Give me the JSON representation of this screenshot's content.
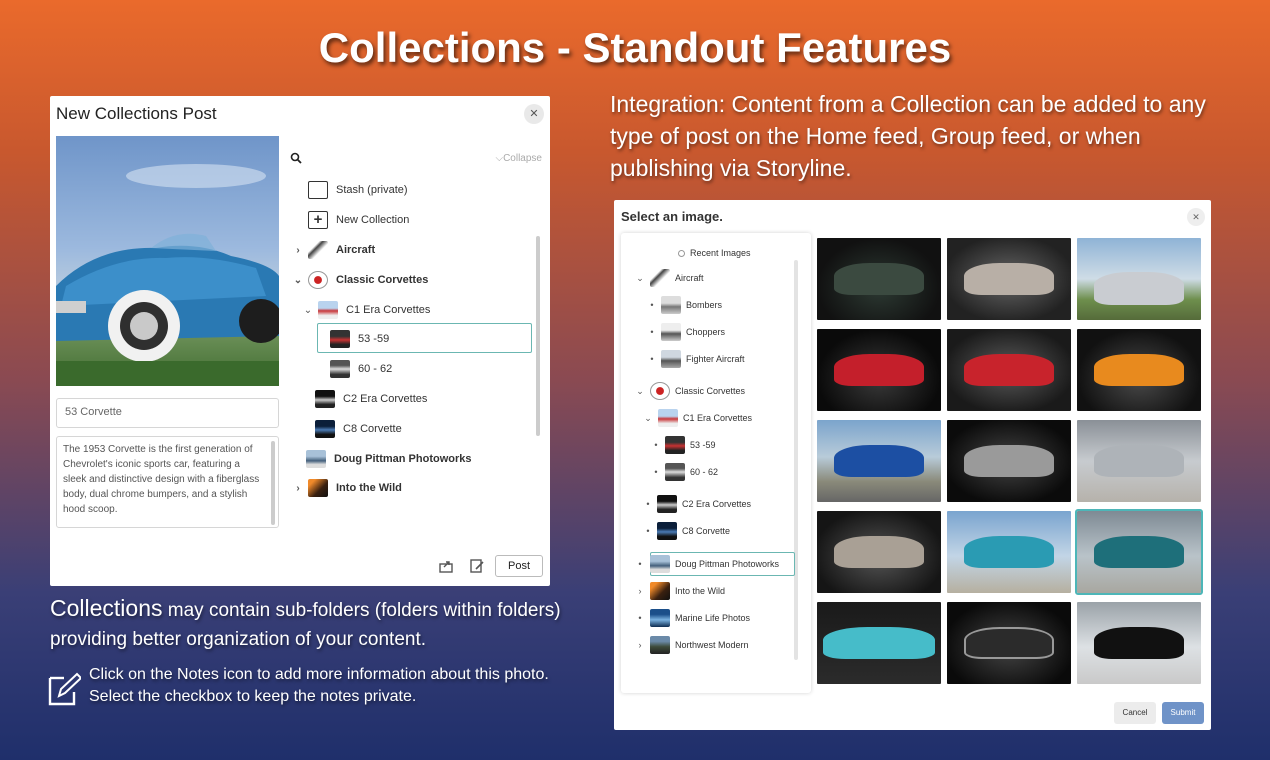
{
  "headline": "Collections - Standout Features",
  "new_post_dialog": {
    "title": "New Collections Post",
    "close_icon": "close-icon",
    "search_icon": "search-icon",
    "collapse_label": "Collapse",
    "title_value": "53 Corvette",
    "notes_value": "The 1953 Corvette is the first generation of Chevrolet's iconic sports car, featuring a sleek and distinctive design with a fiberglass body, dual chrome bumpers, and a stylish hood scoop.",
    "tree": [
      {
        "label": "Stash (private)",
        "icon": "stash-icon"
      },
      {
        "label": "New Collection",
        "icon": "plus-box-icon"
      },
      {
        "label": "Aircraft",
        "icon": "aircraft-thumbnail"
      },
      {
        "label": "Classic Corvettes",
        "icon": "corvette-logo"
      },
      {
        "label": "C1 Era Corvettes",
        "icon": "folder-thumbnail"
      },
      {
        "label": "53 -59",
        "icon": "folder-thumbnail"
      },
      {
        "label": "60 - 62",
        "icon": "folder-thumbnail"
      },
      {
        "label": "C2 Era Corvettes",
        "icon": "folder-thumbnail"
      },
      {
        "label": "C8 Corvette",
        "icon": "folder-thumbnail"
      },
      {
        "label": "Doug Pittman Photoworks",
        "icon": "folder-thumbnail"
      },
      {
        "label": "Into the Wild",
        "icon": "folder-thumbnail"
      }
    ],
    "share_icon": "share-icon",
    "notes_icon": "notes-edit-icon",
    "post_label": "Post"
  },
  "integration_text": "Integration: Content from a Collection can be added to any type of post on the Home feed, Group feed, or when publishing via Storyline.",
  "collections_note": {
    "lead": "Collections",
    "rest": " may contain sub-folders (folders within folders) providing better organization of your content."
  },
  "notes_tip": "Click on the Notes icon to add more information about this photo. Select the checkbox to keep the notes private.",
  "select_image_dialog": {
    "title": "Select an image.",
    "tree": [
      {
        "label": "Recent Images"
      },
      {
        "label": "Aircraft"
      },
      {
        "label": "Bombers"
      },
      {
        "label": "Choppers"
      },
      {
        "label": "Fighter Aircraft"
      },
      {
        "label": "Classic Corvettes"
      },
      {
        "label": "C1 Era Corvettes"
      },
      {
        "label": "53 -59"
      },
      {
        "label": "60 - 62"
      },
      {
        "label": "C2 Era Corvettes"
      },
      {
        "label": "C8 Corvette"
      },
      {
        "label": "Doug Pittman Photoworks"
      },
      {
        "label": "Into the Wild"
      },
      {
        "label": "Marine Life Photos"
      },
      {
        "label": "Northwest Modern"
      }
    ],
    "images": [
      "dark hot rod",
      "silver fastback rear",
      "silver gullwing",
      "red hot rod front",
      "red hot rod rear",
      "orange roadster",
      "blue pickup truck",
      "chrome grille front",
      "porsche rear",
      "silver sedan",
      "teal pickup truck",
      "teal pickup truck selected",
      "turquoise tail fin",
      "black hot rod front",
      "black speedster"
    ],
    "selected_image_index": 11,
    "cancel_label": "Cancel",
    "submit_label": "Submit"
  }
}
